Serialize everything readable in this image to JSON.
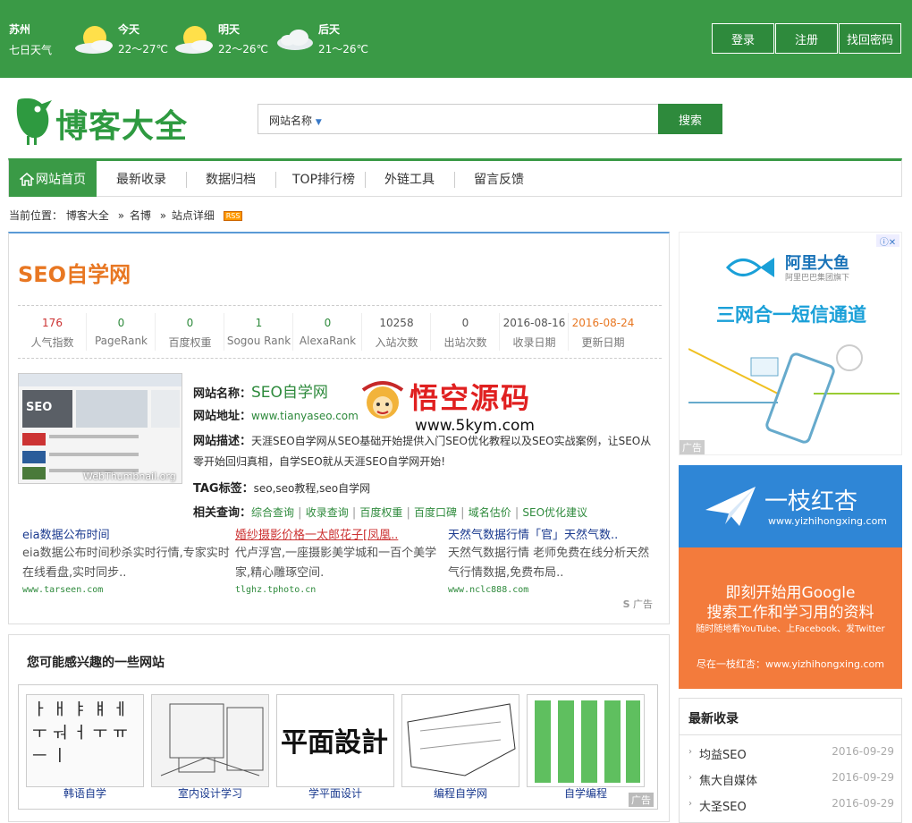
{
  "topbar": {
    "city": "苏州",
    "week_label": "七日天气",
    "weather": [
      {
        "day": "今天",
        "temp": "22～27℃",
        "icon": "sun-cloud-icon"
      },
      {
        "day": "明天",
        "temp": "22～26℃",
        "icon": "sun-cloud-icon"
      },
      {
        "day": "后天",
        "temp": "21～26℃",
        "icon": "cloud-icon"
      }
    ],
    "buttons": {
      "login": "登录",
      "register": "注册",
      "recover": "找回密码"
    }
  },
  "logo": {
    "text": "博客大全"
  },
  "search": {
    "type": "网站名称",
    "placeholder": "",
    "button": "搜索"
  },
  "nav": {
    "home": "网站首页",
    "items": [
      "最新收录",
      "数据归档",
      "TOP排行榜",
      "外链工具",
      "留言反馈"
    ]
  },
  "breadcrumb": {
    "prefix": "当前位置：",
    "items": [
      "博客大全",
      "名博",
      "站点详细"
    ],
    "sep": "»",
    "rss": "RSS"
  },
  "site": {
    "title": "SEO自学网",
    "stats": [
      {
        "value": "176",
        "label": "人气指数",
        "color": "#cc3333"
      },
      {
        "value": "0",
        "label": "PageRank",
        "color": "#2e8a3c"
      },
      {
        "value": "0",
        "label": "百度权重",
        "color": "#2e8a3c"
      },
      {
        "value": "1",
        "label": "Sogou Rank",
        "color": "#2e8a3c"
      },
      {
        "value": "0",
        "label": "AlexaRank",
        "color": "#2e8a3c"
      },
      {
        "value": "10258",
        "label": "入站次数",
        "color": "#555555"
      },
      {
        "value": "0",
        "label": "出站次数",
        "color": "#555555"
      },
      {
        "value": "2016-08-16",
        "label": "收录日期",
        "color": "#555555"
      },
      {
        "value": "2016-08-24",
        "label": "更新日期",
        "color": "#e87722"
      }
    ],
    "name_label": "网站名称：",
    "name": "SEO自学网",
    "url_label": "网站地址：",
    "url": "www.tianyaseo.com",
    "desc_label": "网站描述：",
    "desc": "天涯SEO自学网从SEO基础开始提供入门SEO优化教程以及SEO实战案例，让SEO从零开始回归真相，自学SEO就从天涯SEO自学网开始!",
    "tag_label": "TAG标签：",
    "tags": "seo,seo教程,seo自学网",
    "query_label": "相关查询：",
    "queries": [
      "综合查询",
      "收录查询",
      "百度权重",
      "百度口碑",
      "域名估价",
      "SEO优化建议"
    ],
    "thumb_watermark": "WebThumbnail.org"
  },
  "ads": [
    {
      "title": "eia数据公布时间",
      "body": "eia数据公布时间秒杀实时行情,专家实时在线看盘,实时同步..",
      "url": "www.tarseen.com"
    },
    {
      "title": "婚纱摄影价格一太郎花子[凤凰..",
      "body": "代卢浮宫,一座摄影美学城和一百个美学家,精心雕琢空间.",
      "url": "tlghz.tphoto.cn"
    },
    {
      "title": "天然气数据行情「官」天然气数..",
      "body": "天然气数据行情 老师免费在线分析天然气行情数据,免费布局..",
      "url": "www.nclc888.com"
    }
  ],
  "ad_tag": "广告",
  "watermark": {
    "title": "悟空源码",
    "url": "www.5kym.com"
  },
  "related": {
    "title": "您可能感兴趣的一些网站",
    "items": [
      "韩语自学",
      "室内设计学习",
      "学平面设计",
      "编程自学网",
      "自学编程"
    ],
    "ad_tag": "广告"
  },
  "right_ad1": {
    "brand": "阿里大鱼",
    "sub": "阿里巴巴集团旗下",
    "headline": "三网合一短信通道",
    "tag": "广告"
  },
  "right_ad2": {
    "brand": "一枝红杏",
    "url": "www.yizhihongxing.com",
    "line1": "即刻开始用Google",
    "line2": "搜索工作和学习用的资料",
    "line3": "随时随地看YouTube、上Facebook、发Twitter",
    "line4": "尽在一枝红杏：www.yizhihongxing.com"
  },
  "latest": {
    "title": "最新收录",
    "items": [
      {
        "name": "均益SEO",
        "date": "2016-09-29"
      },
      {
        "name": "焦大自媒体",
        "date": "2016-09-29"
      },
      {
        "name": "大圣SEO",
        "date": "2016-09-29"
      }
    ]
  }
}
